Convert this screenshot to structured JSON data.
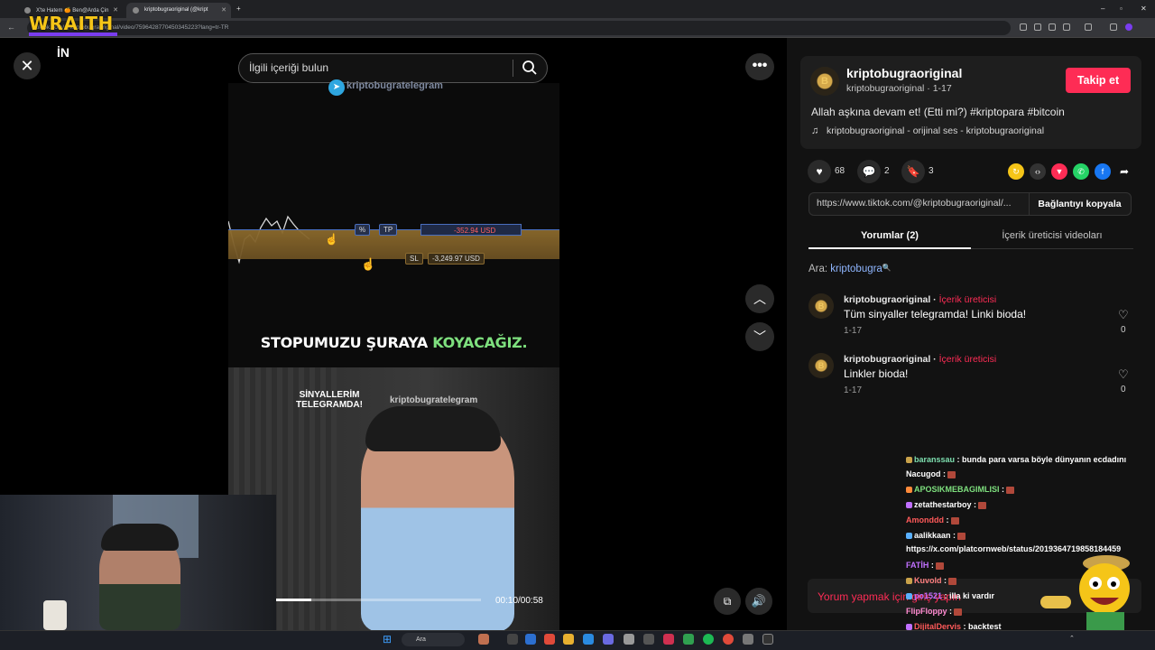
{
  "browser": {
    "tabs": [
      {
        "title": "X'te Hatem 🍊 Ben@Arda Çin"
      },
      {
        "title": "kriptobugraoriginal (@kript"
      }
    ],
    "url": "tiktok.com/@kriptobugraoriginal/video/7596428770450345223?lang=tr-TR"
  },
  "overlay": {
    "wraith": "WRAITH",
    "in_logo": "İN"
  },
  "search": {
    "placeholder": "İlgili içeriği bulun"
  },
  "video": {
    "watermark_top": "kriptobugratelegram",
    "chip_tp_pct": "%",
    "chip_tp": "TP",
    "chip_pnl": "-352.94 USD",
    "chip_sl": "SL",
    "chip_sl_value": "-3,249.97 USD",
    "caption_white": "STOPUMUZU ŞURAYA ",
    "caption_green": "KOYACAĞIZ.",
    "cam_text": "SİNYALLERİM TELEGRAMDA!",
    "cam_watermark": "kriptobugratelegram",
    "time": "00:10/00:58",
    "progress": 0.17
  },
  "post": {
    "username": "kriptobugraoriginal",
    "usermeta": "kriptobugraoriginal · 1-17",
    "follow_label": "Takip et",
    "description": "Allah aşkına devam et! (Etti mi?) #kriptopara #bitcoin",
    "music": "kriptobugraoriginal - orijinal ses - kriptobugraoriginal",
    "likes": "68",
    "comments": "2",
    "saves": "3",
    "link": "https://www.tiktok.com/@kriptobugraoriginal/...",
    "copy_label": "Bağlantıyı kopyala",
    "tab_comments": "Yorumlar (2)",
    "tab_videos": "İçerik üreticisi videoları",
    "search_hint_prefix": "Ara: ",
    "search_hint_term": "kriptobugra"
  },
  "comments": [
    {
      "user": "kriptobugraoriginal",
      "role": "İçerik üreticisi",
      "text": "Tüm sinyaller telegramda! Linki bioda!",
      "date": "1-17",
      "likes": "0"
    },
    {
      "user": "kriptobugraoriginal",
      "role": "İçerik üreticisi",
      "text": "Linkler bioda!",
      "date": "1-17",
      "likes": "0"
    }
  ],
  "comment_bar": "Yorum yapmak için giriş yapın",
  "chat": [
    {
      "user": "baranssau",
      "color": "#7ee0b0",
      "msg": ": bunda para varsa böyle dünyanın ecdadını"
    },
    {
      "user": "Nacugod",
      "color": "#ffffff",
      "msg": ":"
    },
    {
      "user": "APOSIKMEBAGIMLISI",
      "color": "#7ee07e",
      "msg": ":"
    },
    {
      "user": "zetathestarboy",
      "color": "#ffffff",
      "msg": ":"
    },
    {
      "user": "Amonddd",
      "color": "#ff5a5a",
      "msg": ":"
    },
    {
      "user": "aalikkaan",
      "color": "#ffffff",
      "msg": ":"
    },
    {
      "user": "",
      "color": "#ffffff",
      "msg": "https://x.com/platcornweb/status/2019364719858184459"
    },
    {
      "user": "FATİH",
      "color": "#c070ff",
      "msg": ":"
    },
    {
      "user": "Kuvold",
      "color": "#ff8080",
      "msg": ":"
    },
    {
      "user": "po1521",
      "color": "#c070ff",
      "msg": ": illa ki vardır"
    },
    {
      "user": "FlipFloppy",
      "color": "#ff8ad0",
      "msg": ":"
    },
    {
      "user": "DijitalDervis",
      "color": "#ff5a5a",
      "msg": ": backtest"
    }
  ],
  "taskbar": {
    "search": "Ara"
  }
}
